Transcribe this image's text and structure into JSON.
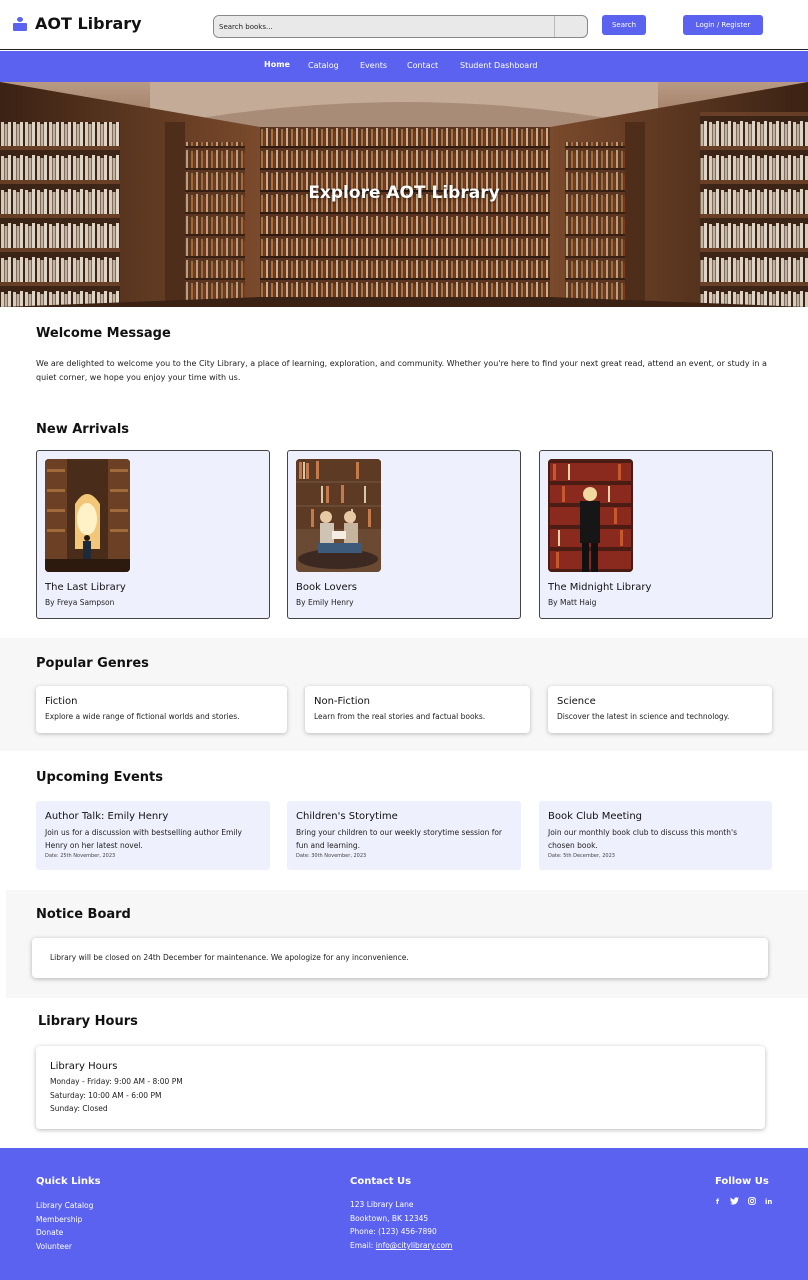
{
  "header": {
    "logo_text": "AOT Library",
    "search_placeholder": "Search books...",
    "search_button": "Search",
    "login_button": "Login / Register"
  },
  "nav": {
    "items": [
      "Home",
      "Catalog",
      "Events",
      "Contact",
      "Student Dashboard"
    ],
    "active": "Home"
  },
  "hero": {
    "title": "Explore AOT Library"
  },
  "welcome": {
    "title": "Welcome Message",
    "text": "We are delighted to welcome you to the City Library, a place of learning, exploration, and community. Whether you're here to find your next great read, attend an event, or study in a quiet corner, we hope you enjoy your time with us."
  },
  "new_arrivals": {
    "title": "New Arrivals",
    "books": [
      {
        "title": "The Last Library",
        "author": "By Freya Sampson"
      },
      {
        "title": "Book Lovers",
        "author": "By Emily Henry"
      },
      {
        "title": "The Midnight Library",
        "author": "By Matt Haig"
      }
    ]
  },
  "genres": {
    "title": "Popular Genres",
    "items": [
      {
        "name": "Fiction",
        "desc": "Explore a wide range of fictional worlds and stories."
      },
      {
        "name": "Non-Fiction",
        "desc": "Learn from the real stories and factual books."
      },
      {
        "name": "Science",
        "desc": "Discover the latest in science and technology."
      }
    ]
  },
  "events": {
    "title": "Upcoming Events",
    "items": [
      {
        "name": "Author Talk: Emily Henry",
        "desc": "Join us for a discussion with bestselling author Emily Henry on her latest novel.",
        "date": "Date: 25th November, 2023"
      },
      {
        "name": "Children's Storytime",
        "desc": "Bring your children to our weekly storytime session for fun and learning.",
        "date": "Date: 30th November, 2023"
      },
      {
        "name": "Book Club Meeting",
        "desc": "Join our monthly book club to discuss this month's chosen book.",
        "date": "Date: 5th December, 2023"
      }
    ]
  },
  "notice": {
    "title": "Notice Board",
    "text": "Library will be closed on 24th December for maintenance. We apologize for any inconvenience."
  },
  "hours": {
    "title": "Library Hours",
    "card_title": "Library Hours",
    "lines": [
      "Monday - Friday: 9:00 AM - 8:00 PM",
      "Saturday: 10:00 AM - 6:00 PM",
      "Sunday: Closed"
    ]
  },
  "footer": {
    "quick_links_title": "Quick Links",
    "quick_links": [
      "Library Catalog",
      "Membership",
      "Donate",
      "Volunteer"
    ],
    "contact_title": "Contact Us",
    "address1": "123 Library Lane",
    "address2": "Booktown, BK 12345",
    "phone": "Phone: (123) 456-7890",
    "email_label": "Email:",
    "email": "info@citylibrary.com",
    "follow_title": "Follow Us",
    "social_icons": [
      "facebook-icon",
      "twitter-icon",
      "instagram-icon",
      "linkedin-icon"
    ],
    "social_glyphs": [
      "f",
      "t",
      "◎",
      "in"
    ]
  },
  "colors": {
    "accent": "#5b62f0",
    "card_tint": "#eef0fd",
    "section_bg": "#f7f7f7"
  }
}
